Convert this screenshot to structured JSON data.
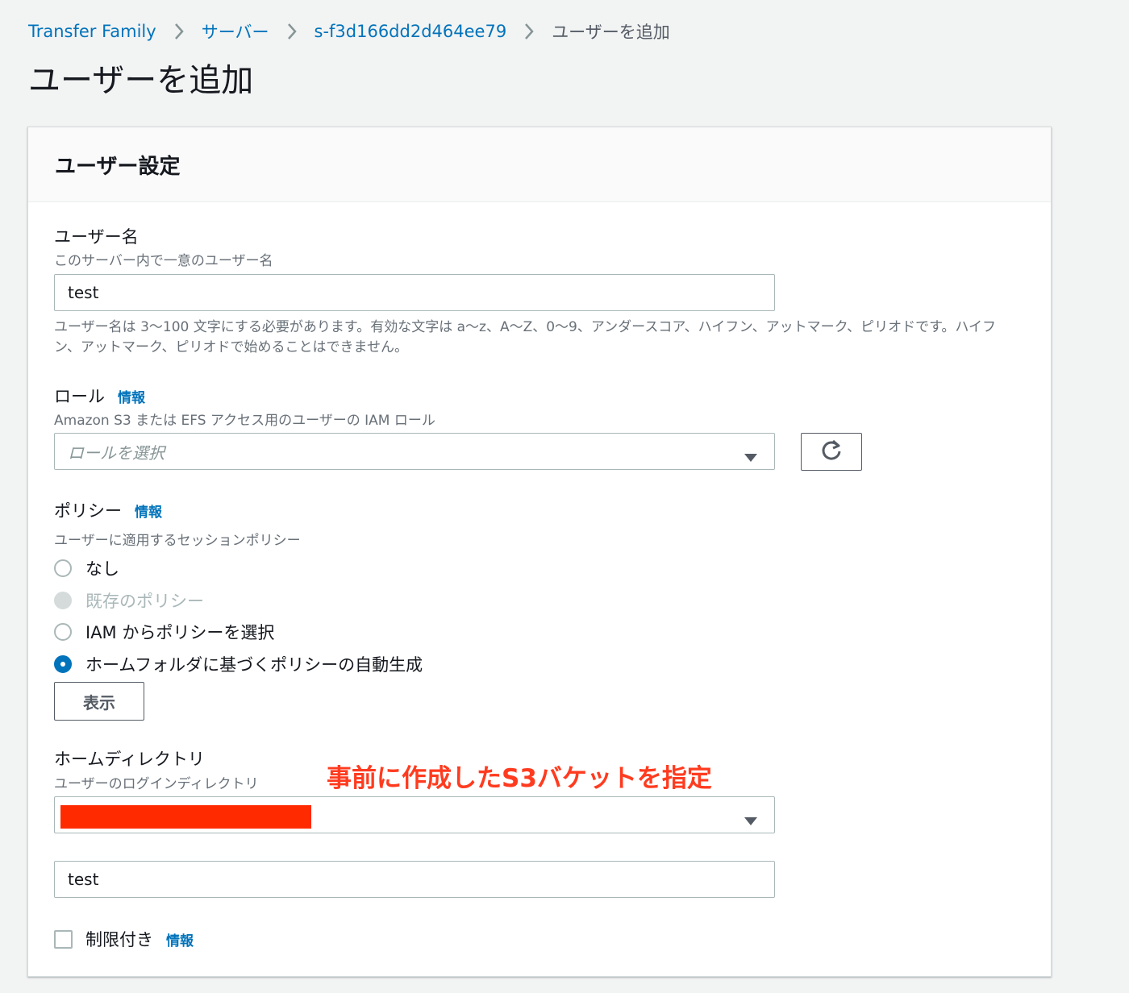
{
  "breadcrumb": {
    "items": [
      "Transfer Family",
      "サーバー",
      "s-f3d166dd2d464ee79"
    ],
    "current": "ユーザーを追加"
  },
  "page_title": "ユーザーを追加",
  "panel": {
    "title": "ユーザー設定",
    "username": {
      "label": "ユーザー名",
      "description": "このサーバー内で一意のユーザー名",
      "value": "test",
      "constraint": "ユーザー名は 3〜100 文字にする必要があります。有効な文字は a〜z、A〜Z、0〜9、アンダースコア、ハイフン、アットマーク、ピリオドです。ハイフン、アットマーク、ピリオドで始めることはできません。"
    },
    "role": {
      "label": "ロール",
      "info": "情報",
      "description": "Amazon S3 または EFS アクセス用のユーザーの IAM ロール",
      "placeholder": "ロールを選択",
      "refresh_icon": "refresh-icon"
    },
    "policy": {
      "label": "ポリシー",
      "info": "情報",
      "description": "ユーザーに適用するセッションポリシー",
      "options": [
        {
          "label": "なし",
          "state": "unchecked"
        },
        {
          "label": "既存のポリシー",
          "state": "disabled"
        },
        {
          "label": "IAM からポリシーを選択",
          "state": "unchecked"
        },
        {
          "label": "ホームフォルダに基づくポリシーの自動生成",
          "state": "checked"
        }
      ],
      "view_button": "表示"
    },
    "home_directory": {
      "label": "ホームディレクトリ",
      "description": "ユーザーのログインディレクトリ",
      "bucket_value": "",
      "path_value": "test"
    },
    "restricted": {
      "label": "制限付き",
      "info": "情報",
      "checked": false
    }
  },
  "annotation": "事前に作成したS3バケットを指定",
  "colors": {
    "link": "#0073bb",
    "annotation": "#ff3b1f",
    "redaction": "#ff2a00",
    "radio_checked": "#0073bb"
  }
}
